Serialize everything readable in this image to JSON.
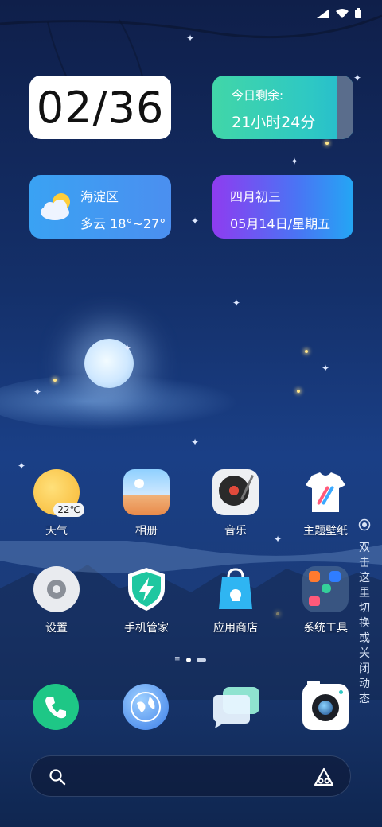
{
  "status_bar": {
    "icons": [
      "signal-icon",
      "wifi-icon",
      "battery-icon"
    ]
  },
  "widgets": {
    "clock": {
      "time": "02/36"
    },
    "remaining": {
      "title": "今日剩余:",
      "value": "21小时24分"
    },
    "weather": {
      "location": "海淀区",
      "summary": "多云 18°~27°"
    },
    "calendar": {
      "lunar": "四月初三",
      "date": "05月14日/星期五"
    }
  },
  "apps": [
    {
      "label": "天气",
      "badge": "22℃",
      "icon": "weather-icon"
    },
    {
      "label": "相册",
      "icon": "gallery-icon"
    },
    {
      "label": "音乐",
      "icon": "music-icon"
    },
    {
      "label": "主题壁纸",
      "icon": "theme-icon"
    },
    {
      "label": "设置",
      "icon": "settings-icon"
    },
    {
      "label": "手机管家",
      "icon": "security-icon"
    },
    {
      "label": "应用商店",
      "icon": "app-store-icon"
    },
    {
      "label": "系统工具",
      "icon": "system-tools-folder-icon"
    }
  ],
  "side_hint": "双击这里切换或关闭动态",
  "dock": [
    "phone-icon",
    "browser-icon",
    "messages-icon",
    "camera-icon"
  ],
  "search": {
    "left_icon": "search-icon",
    "right_icon": "assistant-icon"
  },
  "colors": {
    "remaining_widget": "#41d6a8",
    "weather_widget": "#3aa2f3",
    "calendar_widget": "#8e3cf0"
  }
}
